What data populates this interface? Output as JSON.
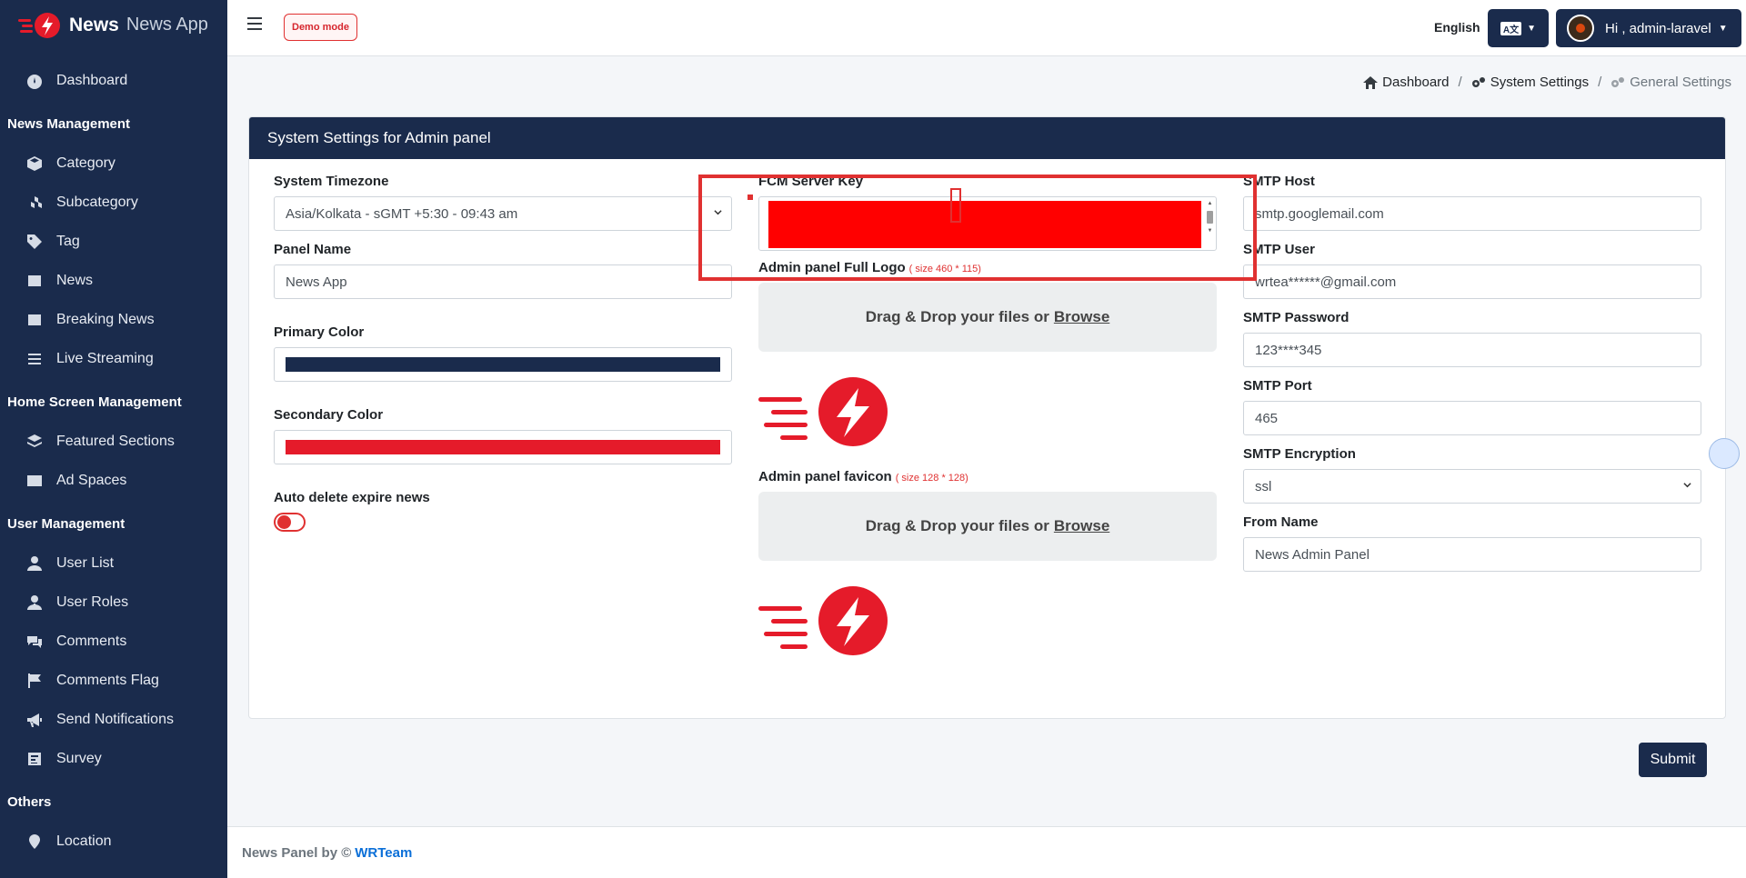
{
  "brand": {
    "name": "News",
    "subtitle": "News App"
  },
  "sidebar": {
    "items": [
      {
        "type": "item",
        "label": "Dashboard",
        "icon": "dashboard-icon"
      },
      {
        "type": "header",
        "label": "News Management"
      },
      {
        "type": "item",
        "label": "Category",
        "icon": "cube-icon"
      },
      {
        "type": "item",
        "label": "Subcategory",
        "icon": "cubes-icon"
      },
      {
        "type": "item",
        "label": "Tag",
        "icon": "tag-icon"
      },
      {
        "type": "item",
        "label": "News",
        "icon": "newspaper-icon"
      },
      {
        "type": "item",
        "label": "Breaking News",
        "icon": "newspaper-icon"
      },
      {
        "type": "item",
        "label": "Live Streaming",
        "icon": "list-icon"
      },
      {
        "type": "header",
        "label": "Home Screen Management"
      },
      {
        "type": "item",
        "label": "Featured Sections",
        "icon": "layers-icon"
      },
      {
        "type": "item",
        "label": "Ad Spaces",
        "icon": "ad-icon"
      },
      {
        "type": "header",
        "label": "User Management"
      },
      {
        "type": "item",
        "label": "User List",
        "icon": "user-icon"
      },
      {
        "type": "item",
        "label": "User Roles",
        "icon": "user-tie-icon"
      },
      {
        "type": "item",
        "label": "Comments",
        "icon": "comments-icon"
      },
      {
        "type": "item",
        "label": "Comments Flag",
        "icon": "flag-icon"
      },
      {
        "type": "item",
        "label": "Send Notifications",
        "icon": "bullhorn-icon"
      },
      {
        "type": "item",
        "label": "Survey",
        "icon": "poll-icon"
      },
      {
        "type": "header",
        "label": "Others"
      },
      {
        "type": "item",
        "label": "Location",
        "icon": "map-marker-icon"
      }
    ]
  },
  "topbar": {
    "demo_label": "Demo mode",
    "language": "English",
    "user_greeting": "Hi , admin-laravel"
  },
  "breadcrumb": {
    "items": [
      "Dashboard",
      "System Settings",
      "General Settings"
    ]
  },
  "card": {
    "title": "System Settings for Admin panel",
    "timezone": {
      "label": "System Timezone",
      "value": "Asia/Kolkata - sGMT +5:30 - 09:43 am"
    },
    "panel_name": {
      "label": "Panel Name",
      "value": "News App"
    },
    "primary_color": {
      "label": "Primary Color",
      "value": "#1a2b4c"
    },
    "secondary_color": {
      "label": "Secondary Color",
      "value": "#e51b2a"
    },
    "auto_delete": {
      "label": "Auto delete expire news",
      "enabled": false
    },
    "fcm": {
      "label": "FCM Server Key"
    },
    "full_logo": {
      "label": "Admin panel Full Logo",
      "hint": "( size 460 * 115)"
    },
    "favicon": {
      "label": "Admin panel favicon",
      "hint": "( size 128 * 128)"
    },
    "dropzone_text": "Drag & Drop your files or",
    "dropzone_link": "Browse",
    "smtp_host": {
      "label": "SMTP Host",
      "value": "smtp.googlemail.com"
    },
    "smtp_user": {
      "label": "SMTP User",
      "value": "wrtea******@gmail.com"
    },
    "smtp_password": {
      "label": "SMTP Password",
      "value": "123****345"
    },
    "smtp_port": {
      "label": "SMTP Port",
      "value": "465"
    },
    "smtp_encryption": {
      "label": "SMTP Encryption",
      "value": "ssl"
    },
    "from_name": {
      "label": "From Name",
      "value": "News Admin Panel"
    }
  },
  "submit_label": "Submit",
  "footer": {
    "text": "News Panel by ©",
    "link": "WRTeam"
  },
  "colors": {
    "navy": "#1a2b4c",
    "accent_red": "#e51b2a"
  }
}
